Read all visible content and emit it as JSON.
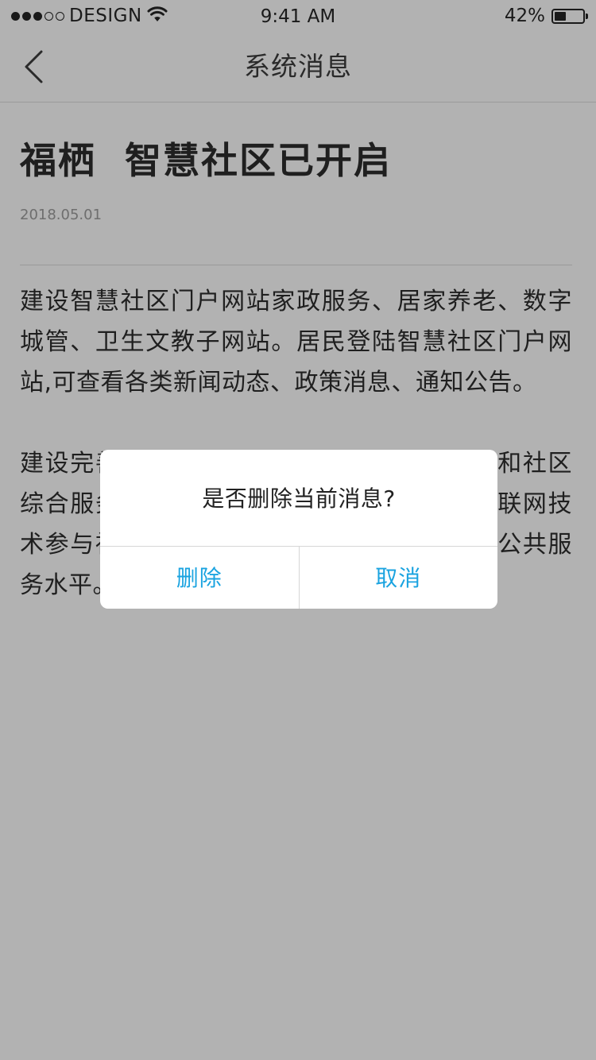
{
  "status_bar": {
    "carrier": "DESIGN",
    "time": "9:41 AM",
    "battery_percent_text": "42%",
    "battery_level": 0.42,
    "signal_bars_filled": 3,
    "signal_bars_total": 5
  },
  "nav": {
    "title": "系统消息",
    "back_icon": "chevron-left-icon"
  },
  "article": {
    "title": "福栖  智慧社区已开启",
    "date": "2018.05.01",
    "paragraphs": [
      "建设智慧社区门户网站家政服务、居家养老、数字城管、卫生文教子网站。居民登陆智慧社区门户网站,可查看各类新闻动态、政策消息、通知公告。",
      "建设完善社区公共服务信息平台，推进社区和社区综合服务中心信息化建设，鼓励居民使用互联网技术参与社区事务管理，全面提升社区管理和公共服务水平。"
    ]
  },
  "dialog": {
    "message": "是否删除当前消息?",
    "delete_label": "删除",
    "cancel_label": "取消"
  },
  "colors": {
    "overlay_background": "#b2b2b2",
    "dialog_background": "#ffffff",
    "accent": "#1aa3e0"
  }
}
